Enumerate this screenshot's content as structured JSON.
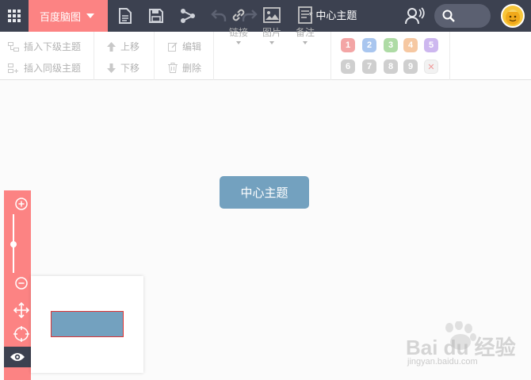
{
  "topbar": {
    "brand_label": "百度脑图",
    "doc_title": "* 中心主题",
    "icons": [
      "apps-grid-icon",
      "new-document-icon",
      "save-icon",
      "share-icon",
      "undo-icon",
      "redo-icon",
      "broadcast-user-icon",
      "search-icon",
      "avatar"
    ]
  },
  "toolbar": {
    "insert_child": "插入下级主题",
    "insert_sibling": "插入同级主题",
    "move_up": "上移",
    "move_down": "下移",
    "edit": "编辑",
    "delete": "删除",
    "link": "链接",
    "image": "图片",
    "note": "备注",
    "priorities": [
      "1",
      "2",
      "3",
      "4",
      "5",
      "6",
      "7",
      "8",
      "9"
    ],
    "priority_clear": "✕"
  },
  "canvas": {
    "center_topic": "中心主题"
  },
  "watermark": {
    "brand": "Bai du 经验",
    "url": "jingyan.baidu.com"
  },
  "colors": {
    "topbar_bg": "#3c4150",
    "brand_bg": "#fc8383",
    "topic_bg": "#73a1bf",
    "zoom_panel_bg": "#fc8383"
  }
}
